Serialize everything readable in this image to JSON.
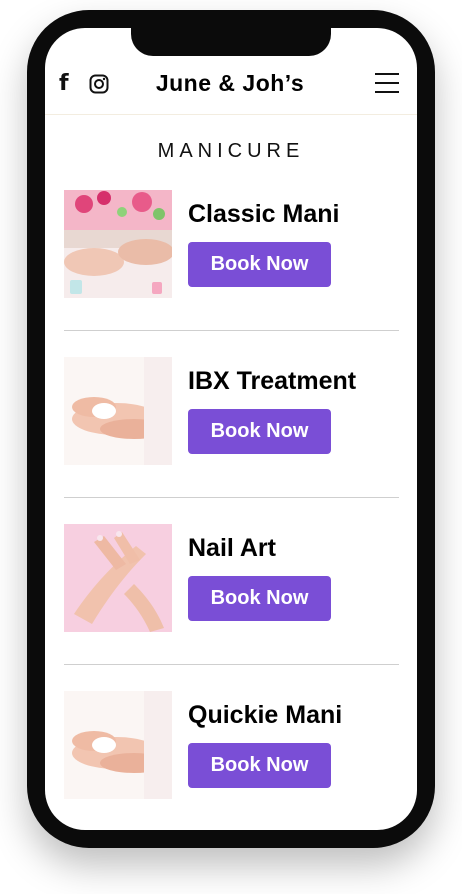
{
  "header": {
    "brand": "June & Joh’s",
    "social_icons": [
      "facebook-icon",
      "instagram-icon"
    ],
    "menu_icon": "hamburger-menu-icon"
  },
  "section": {
    "title": "MANICURE"
  },
  "colors": {
    "button": "#7a4ed6",
    "divider": "#cfcfcf",
    "frame": "#0b0b0b"
  },
  "services": [
    {
      "title": "Classic Mani",
      "button": "Book Now",
      "image": "manicure-salon-photo"
    },
    {
      "title": "IBX Treatment",
      "button": "Book Now",
      "image": "hands-cream-photo"
    },
    {
      "title": "Nail Art",
      "button": "Book Now",
      "image": "pink-nails-photo"
    },
    {
      "title": "Quickie Mani",
      "button": "Book Now",
      "image": "hands-cream-photo"
    }
  ]
}
